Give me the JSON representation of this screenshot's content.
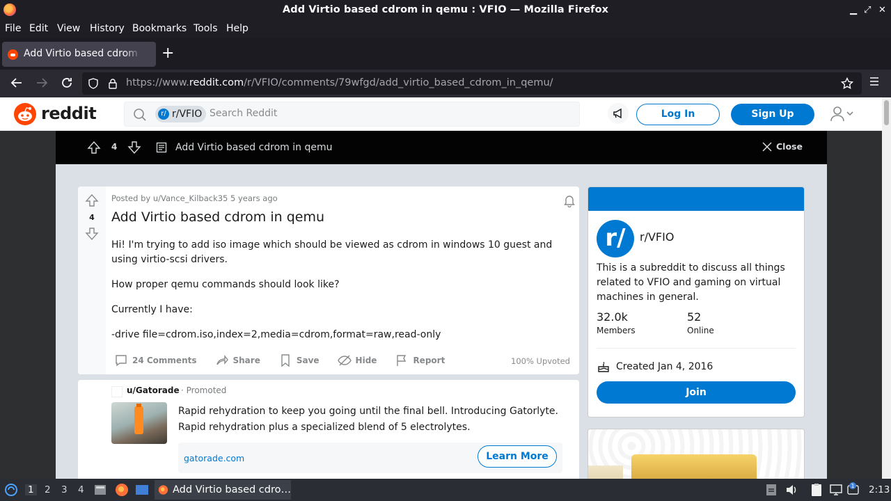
{
  "window": {
    "title": "Add Virtio based cdrom in qemu : VFIO — Mozilla Firefox",
    "controls": [
      "minimize",
      "maximize",
      "close"
    ]
  },
  "menubar": [
    "File",
    "Edit",
    "View",
    "History",
    "Bookmarks",
    "Tools",
    "Help"
  ],
  "tab": {
    "label": "Add Virtio based cdrom in qemu : VFIO",
    "new_tab_label": "+"
  },
  "navbar": {
    "url_prefix": "https://www.",
    "url_host": "reddit.com",
    "url_path": "/r/VFIO/comments/79wfgd/add_virtio_based_cdrom_in_qemu/"
  },
  "reddit_header": {
    "wordmark": "reddit",
    "search_chip": "r/VFIO",
    "search_chip_icon": "r/",
    "search_placeholder": "Search Reddit",
    "login_label": "Log In",
    "signup_label": "Sign Up"
  },
  "postbar": {
    "score": "4",
    "title": "Add Virtio based cdrom in qemu",
    "close_label": "Close"
  },
  "post": {
    "score": "4",
    "meta": "Posted by u/Vance_Kilback35 5 years ago",
    "title": "Add Virtio based cdrom in qemu",
    "body": [
      "Hi! I'm trying to add iso image which should be viewed as cdrom in windows 10 guest and using virtio-scsi drivers.",
      "How proper qemu commands should look like?",
      "Currently I have:",
      "-drive file=cdrom.iso,index=2,media=cdrom,format=raw,read-only"
    ],
    "actions": {
      "comments": "24 Comments",
      "share": "Share",
      "save": "Save",
      "hide": "Hide",
      "report": "Report"
    },
    "upvoted": "100% Upvoted"
  },
  "promo": {
    "user": "u/Gatorade",
    "tag": "· Promoted",
    "text": "Rapid rehydration to keep you going until the final bell. Introducing Gatorlyte. Rapid rehydration plus a specialized blend of 5 electrolytes.",
    "link": "gatorade.com",
    "cta": "Learn More"
  },
  "sidebar": {
    "icon_text": "r/",
    "name": "r/VFIO",
    "description": "This is a subreddit to discuss all things related to VFIO and gaming on virtual machines in general.",
    "members_value": "32.0k",
    "members_label": "Members",
    "online_value": "52",
    "online_label": "Online",
    "created": "Created Jan 4, 2016",
    "join_label": "Join"
  },
  "taskbar": {
    "workspaces": [
      "1",
      "2",
      "3",
      "4"
    ],
    "task_label": "Add Virtio based cdro…",
    "clock": "2:13",
    "notification_count": "1"
  },
  "colors": {
    "reddit_blue": "#0079d3",
    "reddit_orange": "#ff4500",
    "firefox_dark": "#1f1e25"
  }
}
